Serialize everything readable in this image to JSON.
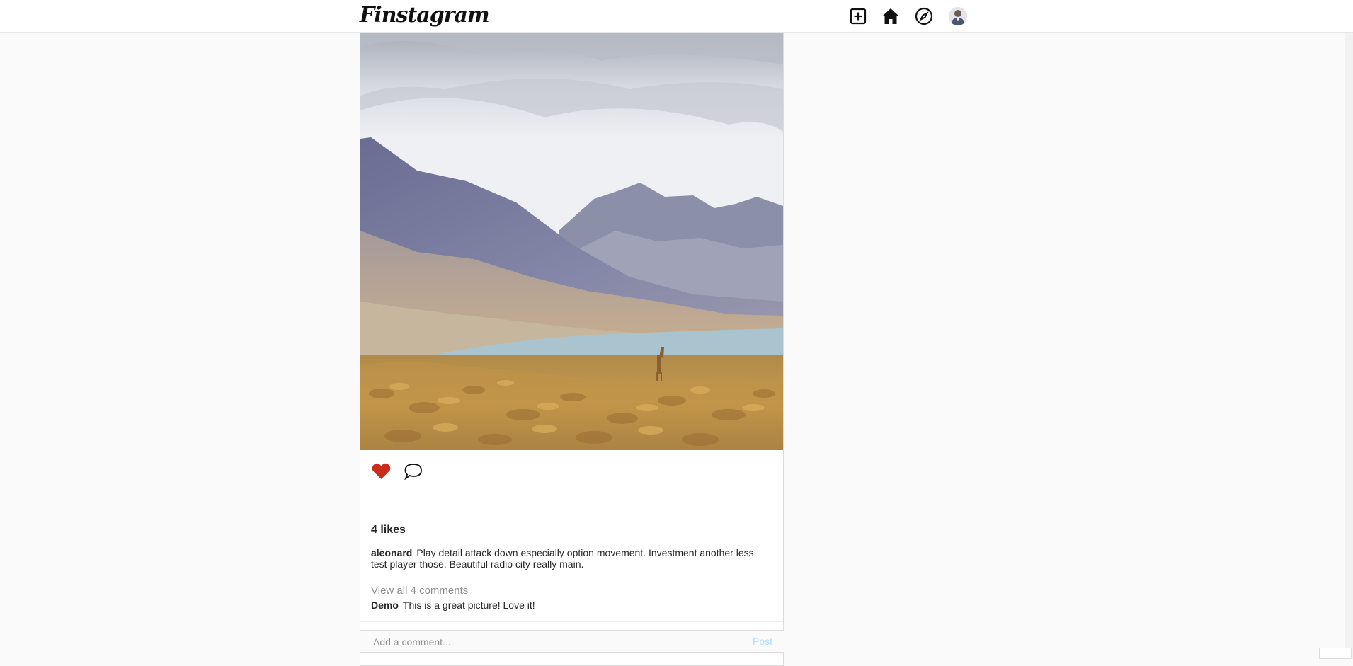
{
  "header": {
    "logo": "Finstagram",
    "icons": [
      "new-post-icon",
      "home-icon",
      "explore-compass-icon",
      "profile-avatar"
    ]
  },
  "post": {
    "image_alt": "Mountain lake landscape with vicuña",
    "likes": "4 likes",
    "liked": true,
    "author": "aleonard",
    "caption": "Play detail attack down especially option movement. Investment another less test player those. Beautiful radio city really main.",
    "view_all_comments": "View all 4 comments",
    "comments": [
      {
        "user": "Demo",
        "text": "This is a great picture! Love it!"
      }
    ],
    "comment_placeholder": "Add a comment...",
    "post_button": "Post"
  },
  "colors": {
    "like_red": "#cc2a1b",
    "post_button": "#b2dffc",
    "muted_text": "#8e8e8e",
    "border": "#dbdbdb"
  }
}
